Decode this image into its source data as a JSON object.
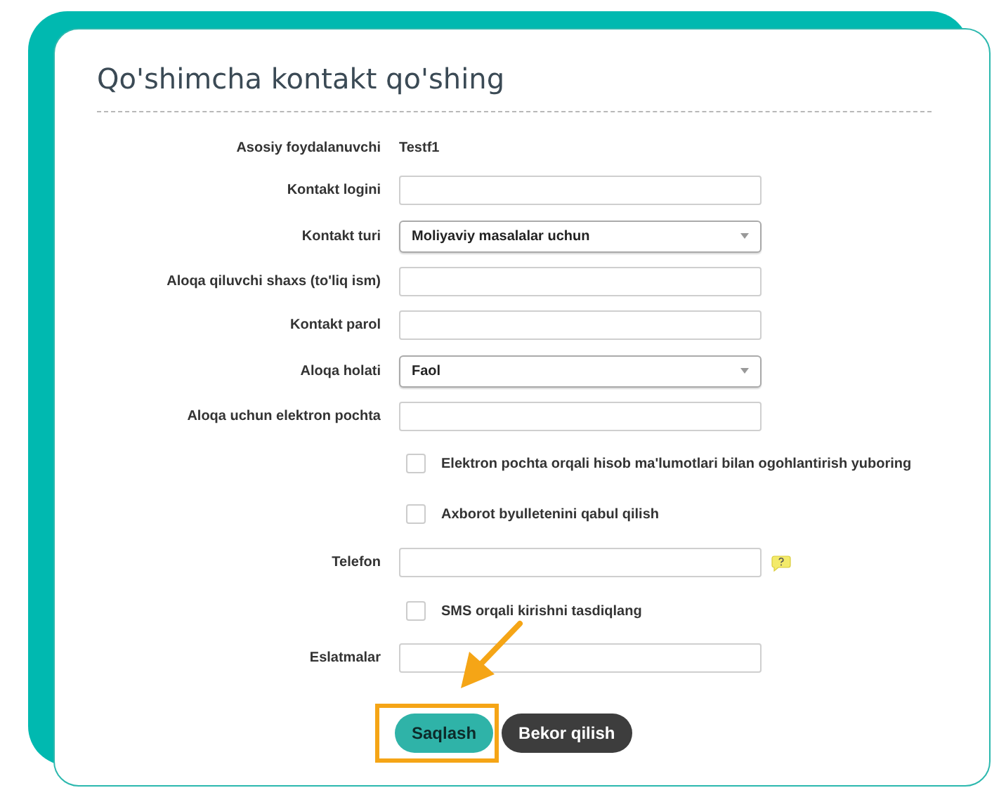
{
  "title": "Qo'shimcha kontakt qo'shing",
  "rows": [
    {
      "kind": "static",
      "label": "Asosiy foydalanuvchi",
      "value": "Testf1"
    },
    {
      "kind": "input",
      "label": "Kontakt logini"
    },
    {
      "kind": "select",
      "label": "Kontakt turi",
      "value": "Moliyaviy masalalar uchun"
    },
    {
      "kind": "input",
      "label": "Aloqa qiluvchi shaxs (to'liq ism)"
    },
    {
      "kind": "input",
      "label": "Kontakt parol"
    },
    {
      "kind": "select",
      "label": "Aloqa holati",
      "value": "Faol"
    },
    {
      "kind": "input",
      "label": "Aloqa uchun elektron pochta"
    },
    {
      "kind": "checkbox",
      "label": "Elektron pochta orqali hisob ma'lumotlari bilan ogohlantirish yuboring",
      "checked": false
    },
    {
      "kind": "checkbox",
      "label": "Axborot byulletenini qabul qilish",
      "checked": false
    },
    {
      "kind": "help_input",
      "label": "Telefon"
    },
    {
      "kind": "checkbox",
      "label": "SMS orqali kirishni tasdiqlang",
      "checked": false
    },
    {
      "kind": "input",
      "label": "Eslatmalar"
    }
  ],
  "buttons": [
    {
      "kind": "primary",
      "label": "Saqlash",
      "highlighted": true
    },
    {
      "kind": "secondary",
      "label": "Bekor qilish",
      "highlighted": false
    }
  ]
}
